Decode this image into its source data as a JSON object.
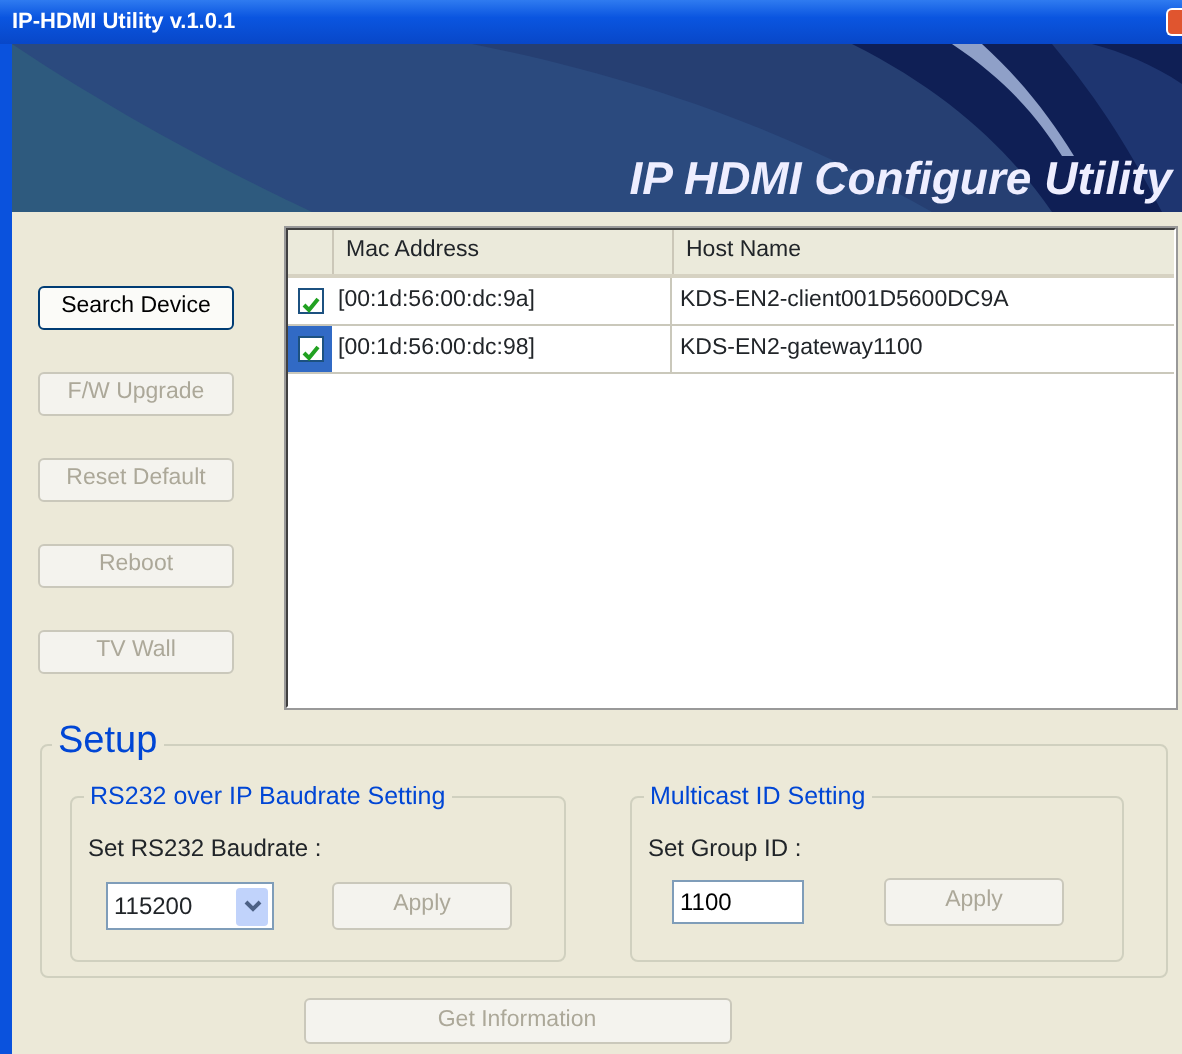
{
  "window": {
    "title": "IP-HDMI Utility v.1.0.1"
  },
  "banner": {
    "title": "IP HDMI Configure Utility"
  },
  "actions": [
    {
      "label": "Search Device",
      "disabled": false
    },
    {
      "label": "F/W Upgrade",
      "disabled": true
    },
    {
      "label": "Reset Default",
      "disabled": true
    },
    {
      "label": "Reboot",
      "disabled": true
    },
    {
      "label": "TV Wall",
      "disabled": true
    }
  ],
  "device_list": {
    "columns": [
      "Mac Address",
      "Host Name"
    ],
    "rows": [
      {
        "checked": true,
        "selected": false,
        "mac": "[00:1d:56:00:dc:9a]",
        "host": "KDS-EN2-client001D5600DC9A"
      },
      {
        "checked": true,
        "selected": true,
        "mac": "[00:1d:56:00:dc:98]",
        "host": "KDS-EN2-gateway1100"
      }
    ]
  },
  "setup": {
    "title": "Setup",
    "baudrate": {
      "title": "RS232 over IP Baudrate Setting",
      "label": "Set RS232 Baudrate :",
      "value": "115200",
      "apply": "Apply",
      "apply_disabled": true
    },
    "multicast": {
      "title": "Multicast ID Setting",
      "label": "Set Group ID :",
      "value": "1100",
      "apply": "Apply",
      "apply_disabled": true
    }
  },
  "get_information": {
    "label": "Get Information",
    "disabled": true
  }
}
